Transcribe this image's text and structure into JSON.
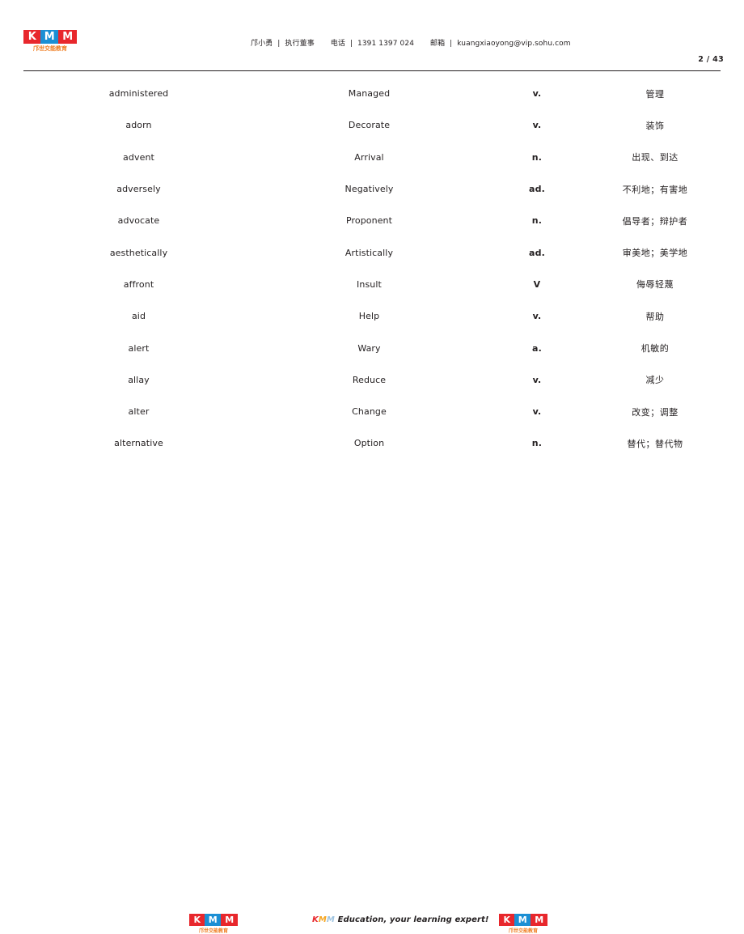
{
  "header": {
    "logo": {
      "k_letter": "K",
      "m1_letter": "M",
      "m2_letter": "M",
      "chinese_subtitle": "邝世交能教育",
      "color_red": "#e8272c",
      "color_blue": "#1b8fd4",
      "color_orange": "#ef7e23"
    },
    "contact_name": "邝小勇",
    "contact_title": "执行董事",
    "phone_label": "电话",
    "phone_value": "1391 1397 024",
    "email_label": "邮箱",
    "email_value": "kuangxiaoyong@vip.sohu.com",
    "separator": "|",
    "page_number": "2 / 43"
  },
  "table": {
    "columns": [
      "word",
      "synonym",
      "part_of_speech",
      "chinese"
    ],
    "rows": [
      {
        "word": "administered",
        "synonym": "Managed",
        "pos": "v.",
        "chinese": "管理"
      },
      {
        "word": "adorn",
        "synonym": "Decorate",
        "pos": "v.",
        "chinese": "装饰"
      },
      {
        "word": "advent",
        "synonym": "Arrival",
        "pos": "n.",
        "chinese": "出现、到达"
      },
      {
        "word": "adversely",
        "synonym": "Negatively",
        "pos": "ad.",
        "chinese": "不利地；有害地"
      },
      {
        "word": "advocate",
        "synonym": "Proponent",
        "pos": "n.",
        "chinese": "倡导者；辩护者"
      },
      {
        "word": "aesthetically",
        "synonym": "Artistically",
        "pos": "ad.",
        "chinese": "审美地；美学地"
      },
      {
        "word": "affront",
        "synonym": "Insult",
        "pos": "V",
        "chinese": "侮辱轻蔑"
      },
      {
        "word": "aid",
        "synonym": "Help",
        "pos": "v.",
        "chinese": "帮助"
      },
      {
        "word": "alert",
        "synonym": "Wary",
        "pos": "a.",
        "chinese": "机敏的"
      },
      {
        "word": "allay",
        "synonym": "Reduce",
        "pos": "v.",
        "chinese": "减少"
      },
      {
        "word": "alter",
        "synonym": "Change",
        "pos": "v.",
        "chinese": "改变；调整"
      },
      {
        "word": "alternative",
        "synonym": "Option",
        "pos": "n.",
        "chinese": "替代；替代物"
      }
    ]
  },
  "footer": {
    "logo": {
      "k_letter": "K",
      "m1_letter": "M",
      "m2_letter": "M",
      "chinese_subtitle": "邝世交能教育"
    },
    "tagline_k": "K",
    "tagline_m1": "M",
    "tagline_m2": "M",
    "tagline_rest": " Education, your learning expert!"
  }
}
